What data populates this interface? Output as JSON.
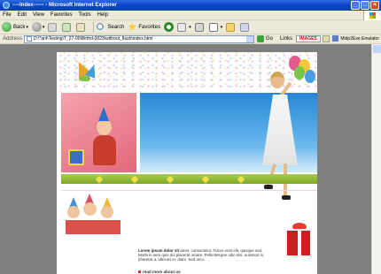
{
  "window": {
    "title": "----Index------ - Microsoft Internet Explorer"
  },
  "menu": {
    "items": [
      "File",
      "Edit",
      "View",
      "Favorites",
      "Tools",
      "Help"
    ]
  },
  "toolbar": {
    "back_label": "Back",
    "search_label": "Search",
    "favorites_label": "Favorites"
  },
  "address": {
    "label": "Address",
    "value": "D:\\*ant\\Testing\\T_27-00\\Birthd-0023\\without_flash\\index.html",
    "go_label": "Go",
    "links_label": "Links",
    "toolbar_logo": "IMAGES",
    "emulator_label": "Midp2Exe Emulator"
  },
  "site": {
    "intro_heading": "Lorem ipsum dolor sit",
    "intro_text": "amet, consectetur. Fusce eros elit, quisque sed. Morbi in sem quis dui placerat ornare. Pellentesque odio nisi, euismod in, pharetra a, ultricies in, diam. Sed arcu.",
    "read_more": "read more about us"
  },
  "colors": {
    "titlebar": "#0A46C9",
    "chrome": "#ECE9D8",
    "viewport_bg": "#7F7F7F",
    "accent_green": "#8DB535",
    "accent_red": "#C8201E"
  }
}
